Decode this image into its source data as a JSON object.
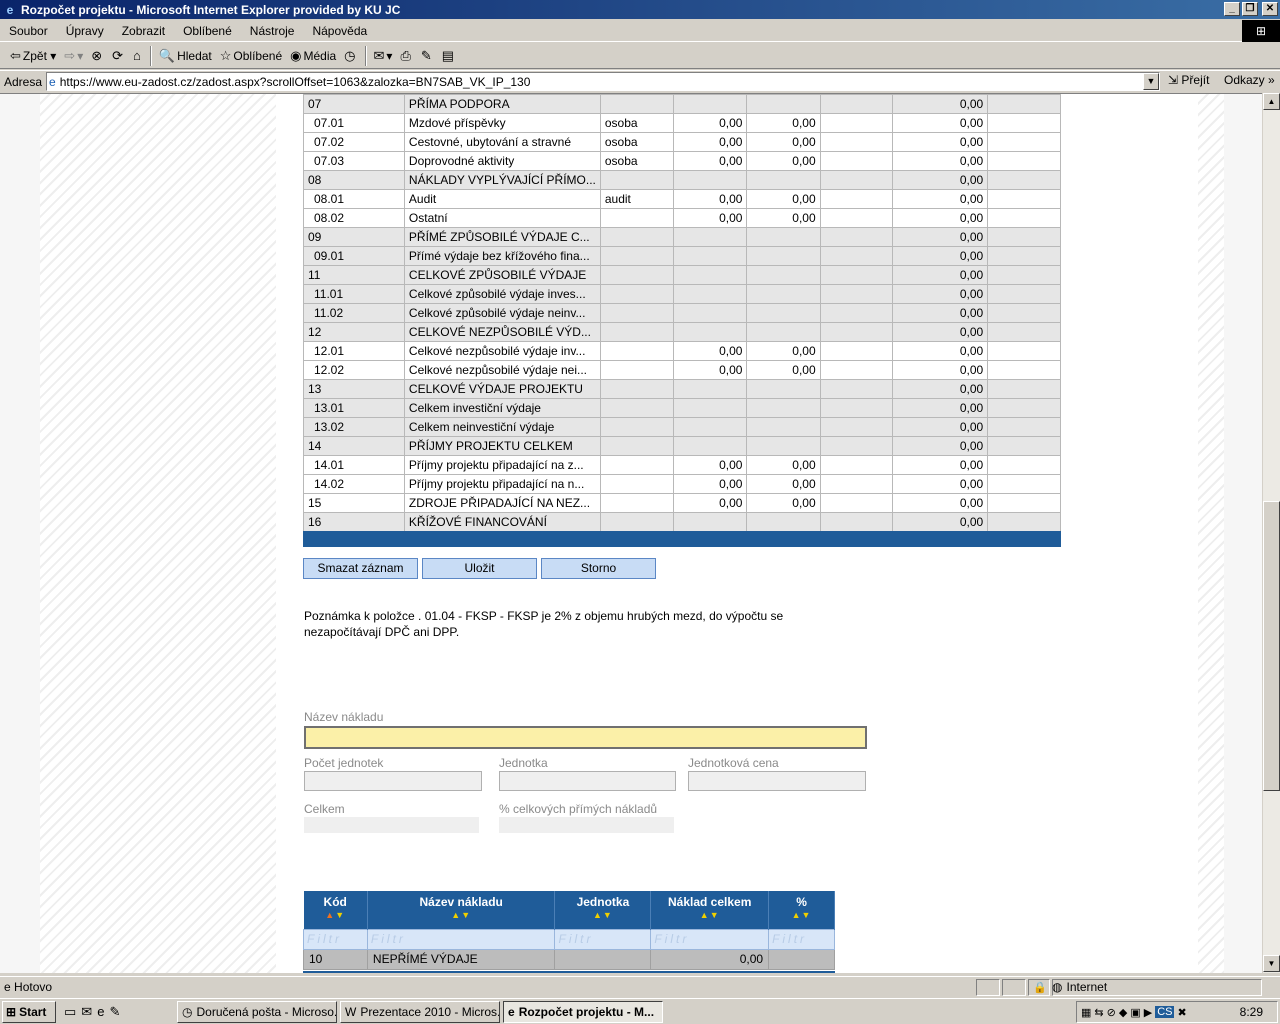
{
  "window": {
    "title": "Rozpočet projektu - Microsoft Internet Explorer provided by KU JC"
  },
  "menu": [
    "Soubor",
    "Úpravy",
    "Zobrazit",
    "Oblíbené",
    "Nástroje",
    "Nápověda"
  ],
  "toolbar": {
    "back": "Zpět",
    "search": "Hledat",
    "favorites": "Oblíbené",
    "media": "Média"
  },
  "address": {
    "label": "Adresa",
    "url": "https://www.eu-zadost.cz/zadost.aspx?scrollOffset=1063&zalozka=BN7SAB_VK_IP_130",
    "go": "Přejít",
    "links": "Odkazy"
  },
  "budget_rows": [
    {
      "code": "07",
      "name": "PŘÍMA PODPORA",
      "unit": "",
      "c1": "",
      "c2": "",
      "c3": "",
      "total": "0,00",
      "group": true
    },
    {
      "code": "07.01",
      "name": "Mzdové příspěvky",
      "unit": "osoba",
      "c1": "0,00",
      "c2": "0,00",
      "c3": "",
      "total": "0,00",
      "group": false
    },
    {
      "code": "07.02",
      "name": "Cestovné, ubytování a stravné",
      "unit": "osoba",
      "c1": "0,00",
      "c2": "0,00",
      "c3": "",
      "total": "0,00",
      "group": false
    },
    {
      "code": "07.03",
      "name": "Doprovodné aktivity",
      "unit": "osoba",
      "c1": "0,00",
      "c2": "0,00",
      "c3": "",
      "total": "0,00",
      "group": false
    },
    {
      "code": "08",
      "name": "NÁKLADY VYPLÝVAJÍCÍ PŘÍMO...",
      "unit": "",
      "c1": "",
      "c2": "",
      "c3": "",
      "total": "0,00",
      "group": true
    },
    {
      "code": "08.01",
      "name": "Audit",
      "unit": "audit",
      "c1": "0,00",
      "c2": "0,00",
      "c3": "",
      "total": "0,00",
      "group": false
    },
    {
      "code": "08.02",
      "name": "Ostatní",
      "unit": "",
      "c1": "0,00",
      "c2": "0,00",
      "c3": "",
      "total": "0,00",
      "group": false
    },
    {
      "code": "09",
      "name": "PŘÍMÉ ZPŮSOBILÉ VÝDAJE C...",
      "unit": "",
      "c1": "",
      "c2": "",
      "c3": "",
      "total": "0,00",
      "group": true
    },
    {
      "code": "09.01",
      "name": "Přímé výdaje bez křížového fina...",
      "unit": "",
      "c1": "",
      "c2": "",
      "c3": "",
      "total": "0,00",
      "group": true
    },
    {
      "code": "11",
      "name": "CELKOVÉ ZPŮSOBILÉ VÝDAJE",
      "unit": "",
      "c1": "",
      "c2": "",
      "c3": "",
      "total": "0,00",
      "group": true
    },
    {
      "code": "11.01",
      "name": "Celkové způsobilé výdaje inves...",
      "unit": "",
      "c1": "",
      "c2": "",
      "c3": "",
      "total": "0,00",
      "group": true
    },
    {
      "code": "11.02",
      "name": "Celkové způsobilé výdaje neinv...",
      "unit": "",
      "c1": "",
      "c2": "",
      "c3": "",
      "total": "0,00",
      "group": true
    },
    {
      "code": "12",
      "name": "CELKOVÉ NEZPŮSOBILÉ VÝD...",
      "unit": "",
      "c1": "",
      "c2": "",
      "c3": "",
      "total": "0,00",
      "group": true
    },
    {
      "code": "12.01",
      "name": "Celkové nezpůsobilé výdaje inv...",
      "unit": "",
      "c1": "0,00",
      "c2": "0,00",
      "c3": "",
      "total": "0,00",
      "group": false
    },
    {
      "code": "12.02",
      "name": "Celkové nezpůsobilé výdaje nei...",
      "unit": "",
      "c1": "0,00",
      "c2": "0,00",
      "c3": "",
      "total": "0,00",
      "group": false
    },
    {
      "code": "13",
      "name": "CELKOVÉ VÝDAJE PROJEKTU",
      "unit": "",
      "c1": "",
      "c2": "",
      "c3": "",
      "total": "0,00",
      "group": true
    },
    {
      "code": "13.01",
      "name": "Celkem investiční výdaje",
      "unit": "",
      "c1": "",
      "c2": "",
      "c3": "",
      "total": "0,00",
      "group": true
    },
    {
      "code": "13.02",
      "name": "Celkem neinvestiční výdaje",
      "unit": "",
      "c1": "",
      "c2": "",
      "c3": "",
      "total": "0,00",
      "group": true
    },
    {
      "code": "14",
      "name": "PŘÍJMY PROJEKTU CELKEM",
      "unit": "",
      "c1": "",
      "c2": "",
      "c3": "",
      "total": "0,00",
      "group": true
    },
    {
      "code": "14.01",
      "name": "Příjmy projektu připadající na z...",
      "unit": "",
      "c1": "0,00",
      "c2": "0,00",
      "c3": "",
      "total": "0,00",
      "group": false
    },
    {
      "code": "14.02",
      "name": "Příjmy projektu připadající na n...",
      "unit": "",
      "c1": "0,00",
      "c2": "0,00",
      "c3": "",
      "total": "0,00",
      "group": false
    },
    {
      "code": "15",
      "name": "ZDROJE PŘIPADAJÍCÍ NA NEZ...",
      "unit": "",
      "c1": "0,00",
      "c2": "0,00",
      "c3": "",
      "total": "0,00",
      "group": false
    },
    {
      "code": "16",
      "name": "KŘÍŽOVÉ FINANCOVÁNÍ",
      "unit": "",
      "c1": "",
      "c2": "",
      "c3": "",
      "total": "0,00",
      "group": true
    }
  ],
  "buttons": {
    "delete": "Smazat záznam",
    "save": "Uložit",
    "cancel": "Storno"
  },
  "note": "Poznámka k položce . 01.04 - FKSP - FKSP je 2% z objemu hrubých mezd, do výpočtu se nezapočítávají DPČ ani DPP.",
  "form": {
    "name_label": "Název nákladu",
    "name_value": "",
    "count_label": "Počet jednotek",
    "unit_label": "Jednotka",
    "unit_price_label": "Jednotková cena",
    "total_label": "Celkem",
    "percent_label": "% celkových přímých nákladů"
  },
  "grid": {
    "headers": [
      "Kód",
      "Název nákladu",
      "Jednotka",
      "Náklad celkem",
      "%"
    ],
    "filter_placeholder": "Filtr",
    "rows": [
      {
        "code": "10",
        "name": "NEPŘÍMÉ VÝDAJE",
        "unit": "",
        "total": "0,00",
        "percent": ""
      }
    ]
  },
  "status": {
    "text": "Hotovo",
    "zone": "Internet"
  },
  "taskbar": {
    "start": "Start",
    "tasks": [
      "Doručená pošta - Microso...",
      "Prezentace 2010 - Micros...",
      "Rozpočet projektu - M..."
    ],
    "clock": "8:29",
    "lang": "CS"
  }
}
